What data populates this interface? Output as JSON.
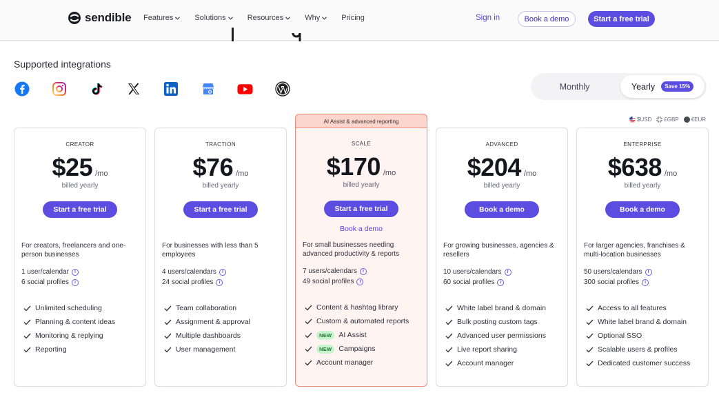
{
  "header": {
    "logo_text": "sendible",
    "nav": [
      {
        "label": "Features"
      },
      {
        "label": "Solutions"
      },
      {
        "label": "Resources"
      },
      {
        "label": "Why"
      },
      {
        "label": "Pricing"
      }
    ],
    "signin_label": "Sign in",
    "demo_label": "Book a demo",
    "trial_label": "Start a free trial"
  },
  "integrations": {
    "label": "Supported integrations",
    "icons": [
      "facebook-icon",
      "instagram-icon",
      "tiktok-icon",
      "x-icon",
      "linkedin-icon",
      "google-business-icon",
      "youtube-icon",
      "wordpress-icon"
    ]
  },
  "billing_toggle": {
    "monthly_label": "Monthly",
    "yearly_label": "Yearly",
    "save_badge": "Save 15%",
    "selected": "Yearly"
  },
  "currency": {
    "options": [
      "$USD",
      "£GBP",
      "€EUR"
    ],
    "selected": "$USD"
  },
  "plans": [
    {
      "name": "CREATOR",
      "price": "$25",
      "per": "/mo",
      "billed": "billed yearly",
      "cta": "Start a free trial",
      "description": "For creators, freelancers and one-person businesses",
      "limits": [
        "1 user/calendar",
        "6 social profiles"
      ],
      "features": [
        {
          "label": "Unlimited scheduling"
        },
        {
          "label": "Planning & content ideas"
        },
        {
          "label": "Monitoring & replying"
        },
        {
          "label": "Reporting"
        }
      ]
    },
    {
      "name": "TRACTION",
      "price": "$76",
      "per": "/mo",
      "billed": "billed yearly",
      "cta": "Start a free trial",
      "description": "For businesses with less than 5 employees",
      "limits": [
        "4 users/calendars",
        "24 social profiles"
      ],
      "features": [
        {
          "label": "Team collaboration"
        },
        {
          "label": "Assignment & approval"
        },
        {
          "label": "Multiple dashboards"
        },
        {
          "label": "User management"
        }
      ]
    },
    {
      "name": "SCALE",
      "banner": "AI Assist & advanced reporting",
      "price": "$170",
      "per": "/mo",
      "billed": "billed yearly",
      "cta": "Start a free trial",
      "secondary_cta": "Book a demo",
      "description": "For small businesses needing advanced productivity & reports",
      "limits": [
        "7 users/calendars",
        "49 social profiles"
      ],
      "features": [
        {
          "label": "Content & hashtag library"
        },
        {
          "label": "Custom & automated reports"
        },
        {
          "label": "AI Assist",
          "badge": "NEW"
        },
        {
          "label": "Campaigns",
          "badge": "NEW"
        },
        {
          "label": "Account manager"
        }
      ]
    },
    {
      "name": "ADVANCED",
      "price": "$204",
      "per": "/mo",
      "billed": "billed yearly",
      "cta": "Book a demo",
      "description": "For growing businesses, agencies & resellers",
      "limits": [
        "10 users/calendars",
        "60 social profiles"
      ],
      "features": [
        {
          "label": "White label brand & domain"
        },
        {
          "label": "Bulk posting custom tags"
        },
        {
          "label": "Advanced user permissions"
        },
        {
          "label": "Live report sharing"
        },
        {
          "label": "Account manager"
        }
      ]
    },
    {
      "name": "ENTERPRISE",
      "price": "$638",
      "per": "/mo",
      "billed": "billed yearly",
      "cta": "Book a demo",
      "description": "For larger agencies, franchises & multi-location businesses",
      "limits": [
        "50 users/calendars",
        "300 social profiles"
      ],
      "features": [
        {
          "label": "Access to all features"
        },
        {
          "label": "White label brand & domain"
        },
        {
          "label": "Optional SSO"
        },
        {
          "label": "Scalable users & profiles"
        },
        {
          "label": "Dedicated customer success"
        }
      ]
    }
  ],
  "colors": {
    "accent": "#5b4de0",
    "featured_bg": "#fff4f2",
    "featured_border": "#ec8c7e",
    "new_badge_bg": "#c9f3cf"
  }
}
